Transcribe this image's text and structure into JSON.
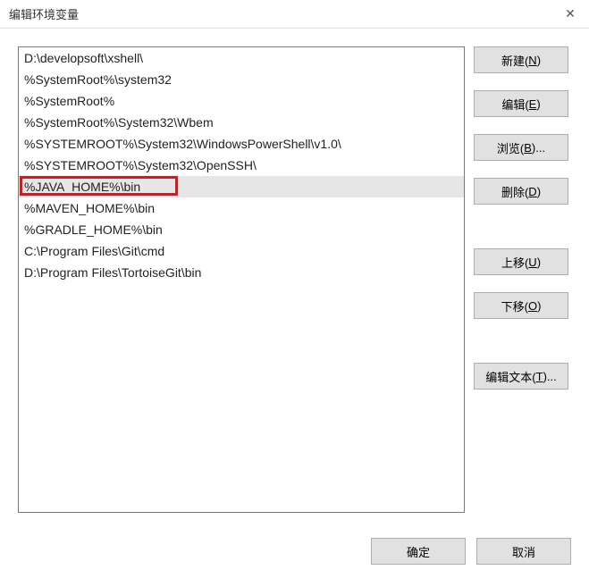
{
  "titlebar": {
    "title": "编辑环境变量",
    "close": "✕"
  },
  "list": {
    "items": [
      "D:\\developsoft\\xshell\\",
      "%SystemRoot%\\system32",
      "%SystemRoot%",
      "%SystemRoot%\\System32\\Wbem",
      "%SYSTEMROOT%\\System32\\WindowsPowerShell\\v1.0\\",
      "%SYSTEMROOT%\\System32\\OpenSSH\\",
      "%JAVA_HOME%\\bin",
      "%MAVEN_HOME%\\bin",
      "%GRADLE_HOME%\\bin",
      "C:\\Program Files\\Git\\cmd",
      "D:\\Program Files\\TortoiseGit\\bin"
    ],
    "selected_index": 6
  },
  "buttons": {
    "new": {
      "label": "新建(",
      "key": "N",
      "tail": ")"
    },
    "edit": {
      "label": "编辑(",
      "key": "E",
      "tail": ")"
    },
    "browse": {
      "label": "浏览(",
      "key": "B",
      "tail": ")..."
    },
    "delete": {
      "label": "删除(",
      "key": "D",
      "tail": ")"
    },
    "moveup": {
      "label": "上移(",
      "key": "U",
      "tail": ")"
    },
    "movedown": {
      "label": "下移(",
      "key": "O",
      "tail": ")"
    },
    "edittext": {
      "label": "编辑文本(",
      "key": "T",
      "tail": ")..."
    },
    "ok": "确定",
    "cancel": "取消"
  }
}
